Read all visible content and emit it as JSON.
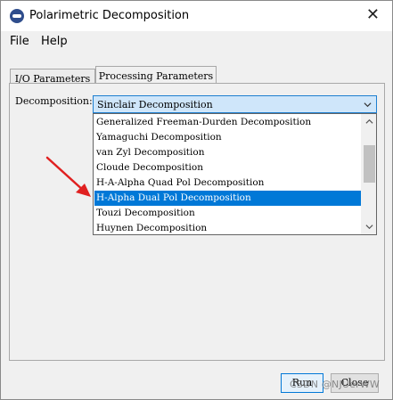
{
  "window": {
    "title": "Polarimetric Decomposition",
    "icon": "app-globe-icon"
  },
  "menu": {
    "items": [
      "File",
      "Help"
    ]
  },
  "tabs": [
    {
      "label": "I/O Parameters",
      "active": false
    },
    {
      "label": "Processing Parameters",
      "active": true
    }
  ],
  "decomposition": {
    "label": "Decomposition:",
    "selected": "Sinclair Decomposition",
    "options": [
      "Generalized Freeman-Durden Decomposition",
      "Yamaguchi Decomposition",
      "van Zyl Decomposition",
      "Cloude Decomposition",
      "H-A-Alpha Quad Pol Decomposition",
      "H-Alpha Dual Pol Decomposition",
      "Touzi Decomposition",
      "Huynen Decomposition"
    ],
    "highlighted_index": 5
  },
  "buttons": {
    "run": "Run",
    "close": "Close"
  },
  "watermark": "CSDN @NJUerWW",
  "colors": {
    "highlight": "#0078d7",
    "annotation_arrow": "#e02020",
    "combo_bg": "#cfe6fa"
  }
}
